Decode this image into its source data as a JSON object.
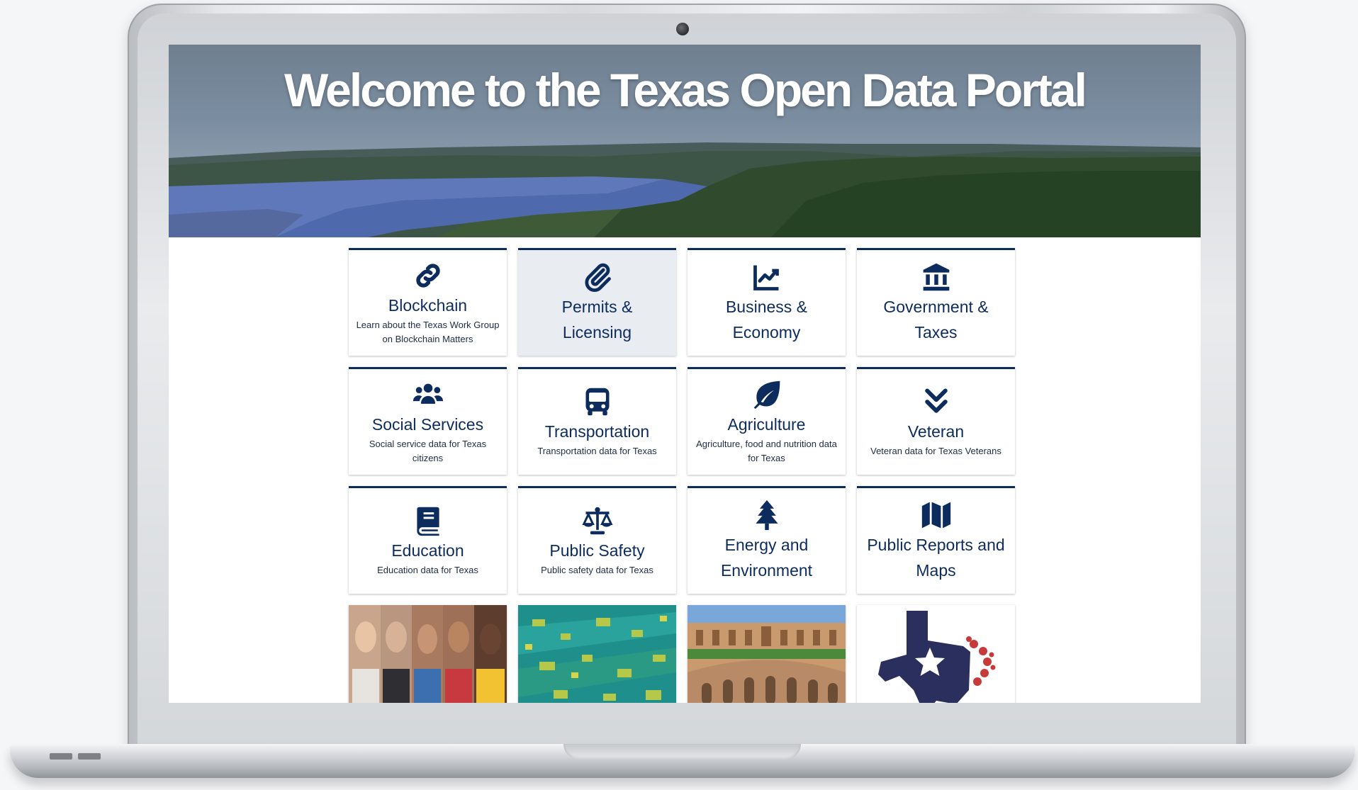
{
  "hero": {
    "title": "Welcome to the Texas Open Data Portal"
  },
  "tiles": [
    {
      "title": "Blockchain",
      "desc": "Learn about the Texas Work Group on Blockchain Matters",
      "icon": "link-icon"
    },
    {
      "title": "Permits & Licensing",
      "desc": "",
      "icon": "paperclip-icon",
      "state": "hover"
    },
    {
      "title": "Business & Economy",
      "desc": "",
      "icon": "chart-line-icon"
    },
    {
      "title": "Government & Taxes",
      "desc": "",
      "icon": "landmark-icon"
    },
    {
      "title": "Social Services",
      "desc": "Social service data for Texas citizens",
      "icon": "users-icon"
    },
    {
      "title": "Transportation",
      "desc": "Transportation data for Texas",
      "icon": "bus-icon"
    },
    {
      "title": "Agriculture",
      "desc": "Agriculture, food and nutrition data for Texas",
      "icon": "leaf-icon"
    },
    {
      "title": "Veteran",
      "desc": "Veteran data for Texas Veterans",
      "icon": "chevron-double-down-icon"
    },
    {
      "title": "Education",
      "desc": "Education data for Texas",
      "icon": "book-icon"
    },
    {
      "title": "Public Safety",
      "desc": "Public safety data for Texas",
      "icon": "balance-scale-icon"
    },
    {
      "title": "Energy and Environment",
      "desc": "",
      "icon": "tree-icon"
    },
    {
      "title": "Public Reports and Maps",
      "desc": "",
      "icon": "map-icon"
    }
  ],
  "photo_tiles": [
    "people-photo",
    "aerial-city-photo",
    "capitol-photo",
    "texas-logo"
  ],
  "colors": {
    "accent": "#0d2c5e",
    "hover_bg": "#e9ecf1"
  }
}
